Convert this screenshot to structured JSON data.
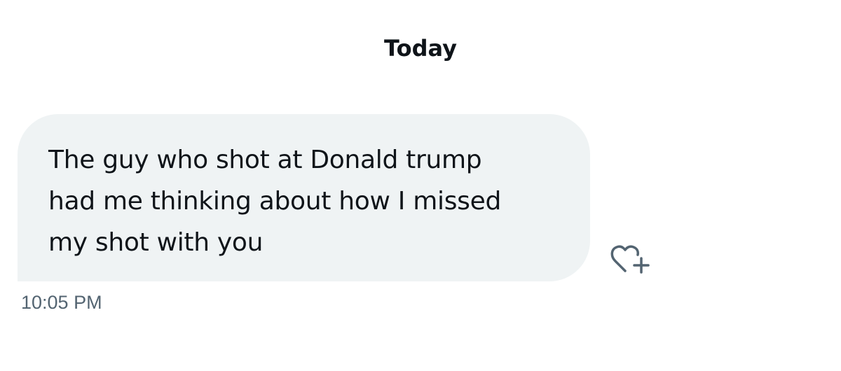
{
  "conversation": {
    "date_separator": "Today",
    "messages": [
      {
        "text": "The guy who shot at Donald trump\nhad me thinking about how I missed\nmy shot with you",
        "timestamp": "10:05 PM",
        "direction": "received"
      }
    ]
  },
  "icons": {
    "react": "heart-plus-icon"
  },
  "colors": {
    "bubble_background": "#eff3f4",
    "text": "#0f1419",
    "secondary_text": "#536471",
    "icon": "#536471"
  }
}
